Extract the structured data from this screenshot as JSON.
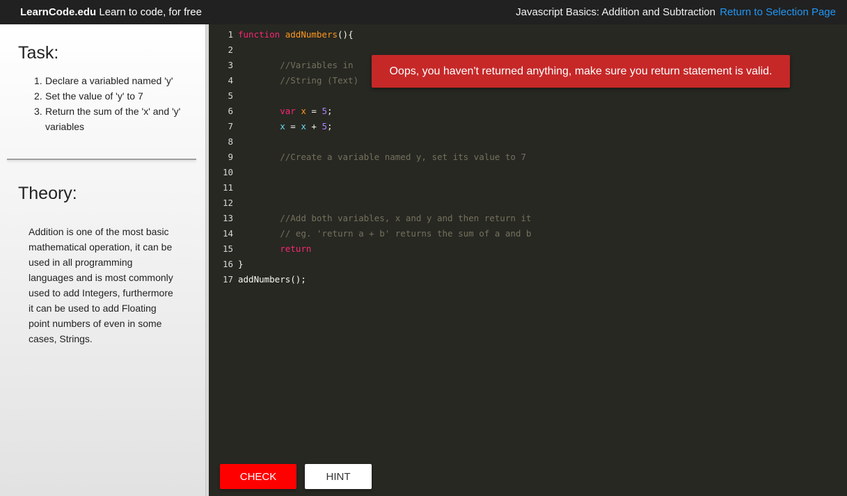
{
  "header": {
    "brand_bold": "LearnCode.edu",
    "brand_tagline": " Learn to code, for free",
    "lesson_title": "Javascript Basics: Addition and Subtraction",
    "return_link": "Return to Selection Page"
  },
  "sidebar": {
    "task_title": "Task:",
    "tasks": [
      {
        "num": "1.",
        "text": "Declare a variabled named 'y'"
      },
      {
        "num": "2.",
        "text": "Set the value of 'y' to 7"
      },
      {
        "num": "3.",
        "text": "Return the sum of the 'x' and 'y' variables"
      }
    ],
    "theory_title": "Theory:",
    "theory_text": "Addition is one of the most basic mathematical operation, it can be used in all programming languages and is most commonly used to add Integers, furthermore it can be used to add Floating point numbers of even in some cases, Strings."
  },
  "editor": {
    "lines": [
      {
        "n": "1",
        "tokens": [
          [
            "kw",
            "function"
          ],
          [
            "txt",
            " "
          ],
          [
            "fn",
            "addNumbers"
          ],
          [
            "txt",
            "(){"
          ]
        ]
      },
      {
        "n": "2",
        "tokens": []
      },
      {
        "n": "3",
        "tokens": [
          [
            "txt",
            "        "
          ],
          [
            "cm",
            "//Variables in"
          ]
        ]
      },
      {
        "n": "4",
        "tokens": [
          [
            "txt",
            "        "
          ],
          [
            "cm",
            "//String (Text)"
          ]
        ]
      },
      {
        "n": "5",
        "tokens": []
      },
      {
        "n": "6",
        "tokens": [
          [
            "txt",
            "        "
          ],
          [
            "kw",
            "var"
          ],
          [
            "txt",
            " "
          ],
          [
            "ob",
            "x"
          ],
          [
            "txt",
            " = "
          ],
          [
            "nm",
            "5"
          ],
          [
            "txt",
            ";"
          ]
        ]
      },
      {
        "n": "7",
        "tokens": [
          [
            "txt",
            "        "
          ],
          [
            "vr",
            "x"
          ],
          [
            "txt",
            " = "
          ],
          [
            "vr",
            "x"
          ],
          [
            "txt",
            " + "
          ],
          [
            "nm",
            "5"
          ],
          [
            "txt",
            ";"
          ]
        ]
      },
      {
        "n": "8",
        "tokens": []
      },
      {
        "n": "9",
        "tokens": [
          [
            "txt",
            "        "
          ],
          [
            "cm",
            "//Create a variable named y, set its value to 7"
          ]
        ]
      },
      {
        "n": "10",
        "tokens": []
      },
      {
        "n": "11",
        "tokens": []
      },
      {
        "n": "12",
        "tokens": []
      },
      {
        "n": "13",
        "tokens": [
          [
            "txt",
            "        "
          ],
          [
            "cm",
            "//Add both variables, x and y and then return it"
          ]
        ]
      },
      {
        "n": "14",
        "tokens": [
          [
            "txt",
            "        "
          ],
          [
            "cm",
            "// eg. 'return a + b' returns the sum of a and b"
          ]
        ]
      },
      {
        "n": "15",
        "tokens": [
          [
            "txt",
            "        "
          ],
          [
            "kw",
            "return"
          ]
        ]
      },
      {
        "n": "16",
        "tokens": [
          [
            "txt",
            "}"
          ]
        ]
      },
      {
        "n": "17",
        "tokens": [
          [
            "txt",
            "addNumbers();"
          ]
        ]
      }
    ]
  },
  "toast": {
    "message": "Oops, you haven't returned anything, make sure you return statement is valid.",
    "color": "#c62828"
  },
  "actions": {
    "check_label": "CHECK",
    "hint_label": "HINT",
    "check_color": "#ff0000"
  }
}
